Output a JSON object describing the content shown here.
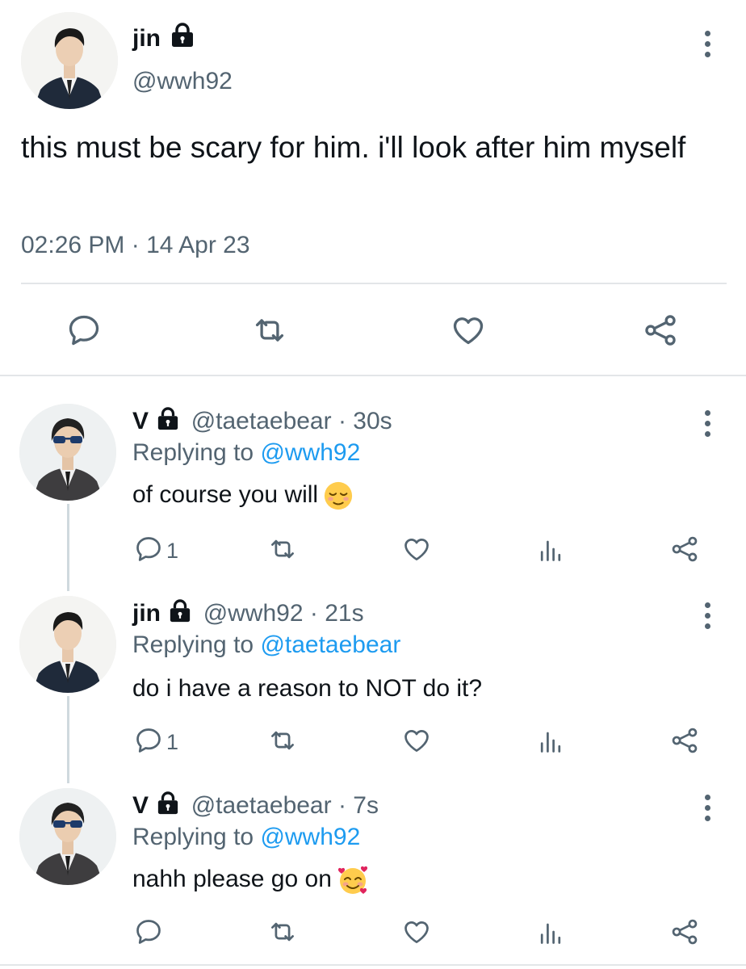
{
  "main_tweet": {
    "name": "jin",
    "handle": "@wwh92",
    "text": "this must be scary for him. i'll look after him myself",
    "time": "02:26 PM",
    "separator": "·",
    "date": "14 Apr 23"
  },
  "replies": [
    {
      "name": "V",
      "handle": "@taetaebear",
      "time": "· 30s",
      "replying_prefix": "Replying to ",
      "replying_to": "@wwh92",
      "text": "of course you will",
      "emoji": "relieved-face",
      "reply_count": "1"
    },
    {
      "name": "jin",
      "handle": "@wwh92",
      "time": "· 21s",
      "replying_prefix": "Replying to ",
      "replying_to": "@taetaebear",
      "text": "do i have a reason to NOT do it?",
      "reply_count": "1"
    },
    {
      "name": "V",
      "handle": "@taetaebear",
      "time": "· 7s",
      "replying_prefix": "Replying to ",
      "replying_to": "@wwh92",
      "text": "nahh please go on",
      "emoji": "smiling-face-with-hearts",
      "reply_count": ""
    }
  ],
  "colors": {
    "text": "#0f1419",
    "secondary": "#536471",
    "link": "#1d9bf0",
    "divider": "#e3e6e8"
  },
  "icons": [
    "lock-icon",
    "more-icon",
    "reply-icon",
    "retweet-icon",
    "like-icon",
    "share-icon",
    "views-icon"
  ]
}
